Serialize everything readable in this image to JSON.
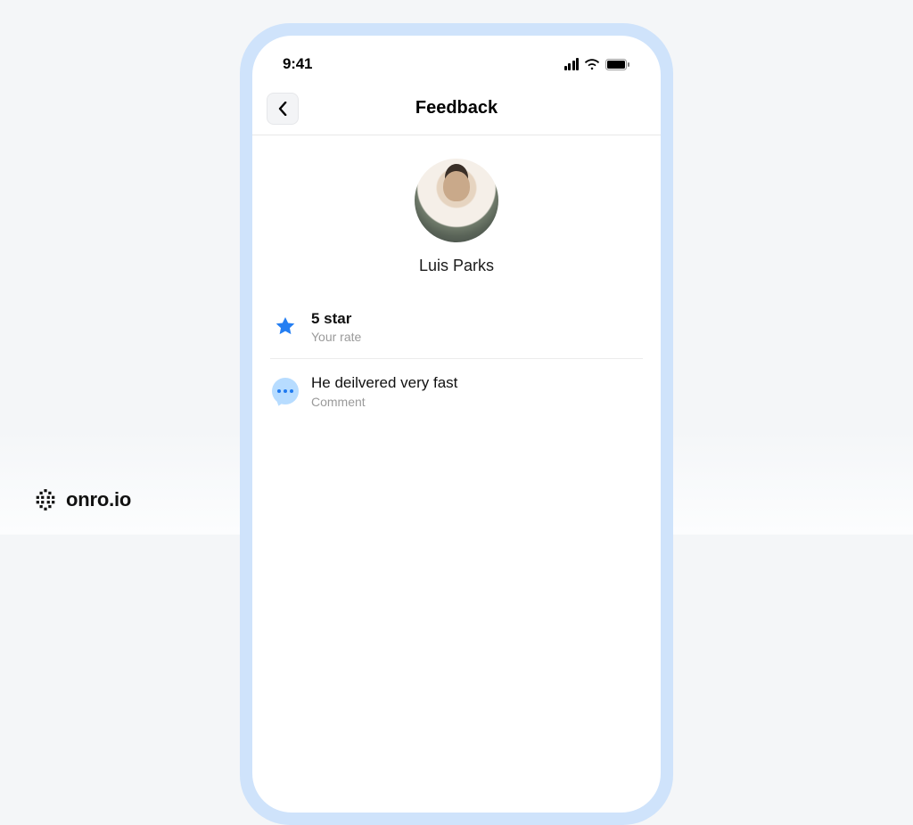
{
  "status_bar": {
    "time": "9:41"
  },
  "header": {
    "title": "Feedback"
  },
  "profile": {
    "name": "Luis Parks"
  },
  "rating": {
    "value": "5 star",
    "label": "Your rate"
  },
  "comment": {
    "text": "He deilvered very fast",
    "label": "Comment"
  },
  "watermark": {
    "text": "onro.io"
  },
  "colors": {
    "accent_blue": "#247ef2",
    "bubble_bg": "#b7dcff",
    "phone_frame": "#cfe3fb"
  }
}
